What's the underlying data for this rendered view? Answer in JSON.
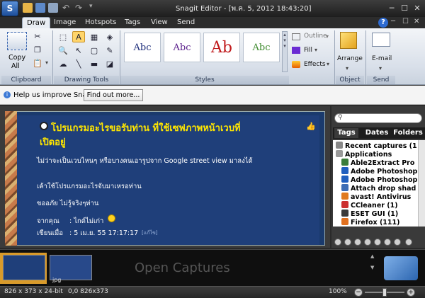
{
  "window": {
    "title": "Snagit Editor - [พ.ค. 5, 2012 18:43:20]",
    "minimize": "─",
    "maximize": "☐",
    "close": "✕",
    "help": "?"
  },
  "tabs": [
    {
      "label": "Draw"
    },
    {
      "label": "Image"
    },
    {
      "label": "Hotspots"
    },
    {
      "label": "Tags"
    },
    {
      "label": "View"
    },
    {
      "label": "Send"
    }
  ],
  "ribbon": {
    "clipboard": {
      "label": "Clipboard",
      "copy_all": "Copy",
      "copy_all2": "All"
    },
    "drawing_tools": {
      "label": "Drawing Tools"
    },
    "styles": {
      "label": "Styles",
      "items": [
        "Abc",
        "Abc",
        "Ab",
        "Abc"
      ]
    },
    "outline": "Outline",
    "fill": "Fill",
    "effects": "Effects",
    "object": {
      "label": "Object",
      "arrange": "Arrange"
    },
    "send": {
      "label": "Send",
      "email": "E-mail"
    }
  },
  "message_bar": {
    "text": "Help us improve Snagit",
    "button": "Find out more..."
  },
  "capture": {
    "title_line1": "โปรแกรมอะไรขอรับท่าน ที่ใช้เซฟภาพหน้าเวบที่",
    "title_line2": "เปิดอยู่",
    "para1": "ไม่ว่าจะเป็นเวบไหนๆ หรือบางคนเอารูปจาก Google street view มาลงได้",
    "para2": "เค้าใช้โปรแกรมอะไรจับมาเหรอท่าน",
    "para3": "ขออภัย ไม่รู้จริงๆท่าน",
    "from_label": "จากคุณ",
    "from_value": ": ไกด์ไม่เก่า",
    "date_label": "เขียนเมื่อ",
    "date_value": ": 5 เม.ย. 55 17:17:17",
    "edit_tag": "[แก้ไข]"
  },
  "library": {
    "tabs": [
      "Tags",
      "Dates",
      "Folders"
    ],
    "tree": [
      {
        "label": "Recent captures (1",
        "color": "#888888"
      },
      {
        "label": "Applications",
        "color": "#9a9a9a"
      },
      {
        "label": "Able2Extract Pro",
        "color": "#3a7d3a"
      },
      {
        "label": "Adobe Photoshop",
        "color": "#1f5fbf"
      },
      {
        "label": "Adobe Photoshop",
        "color": "#1f5fbf"
      },
      {
        "label": "Attach drop shad",
        "color": "#3d6db5"
      },
      {
        "label": "avast! Antivirus",
        "color": "#e07a1f"
      },
      {
        "label": "CCleaner (1)",
        "color": "#cc3030"
      },
      {
        "label": "ESET GUI (1)",
        "color": "#3a3a3a"
      },
      {
        "label": "Firefox (111)",
        "color": "#e0701f"
      }
    ]
  },
  "tray": {
    "open_captures": "Open Captures",
    "thumb_label": "jpg"
  },
  "status": {
    "dimensions": "826 x 373 x 24-bit",
    "coords": "0,0  826x373",
    "zoom": "100%"
  }
}
